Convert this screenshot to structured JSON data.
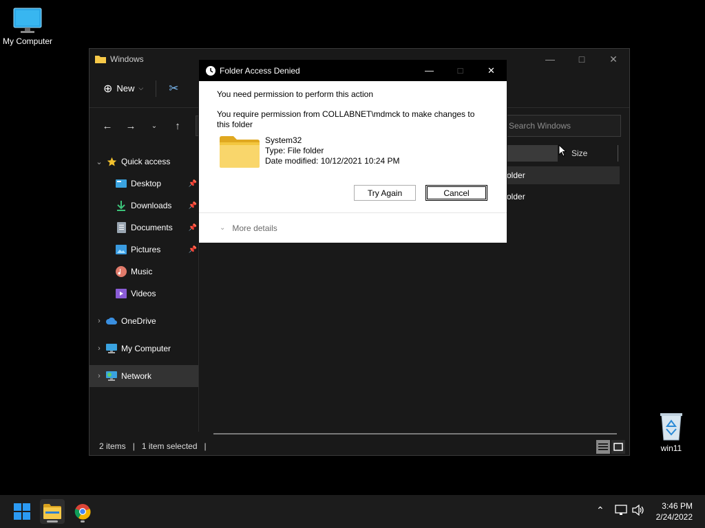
{
  "desktop": {
    "icons": [
      {
        "label": "My Computer"
      },
      {
        "label": "win11"
      }
    ]
  },
  "explorer": {
    "title": "Windows",
    "toolbar": {
      "new_label": "New"
    },
    "search_placeholder": "Search Windows",
    "sidebar": {
      "quick_access": "Quick access",
      "items": [
        {
          "label": "Desktop",
          "icon": "desktop-icon",
          "pinned": true
        },
        {
          "label": "Downloads",
          "icon": "download-icon",
          "pinned": true
        },
        {
          "label": "Documents",
          "icon": "document-icon",
          "pinned": true
        },
        {
          "label": "Pictures",
          "icon": "pictures-icon",
          "pinned": true
        },
        {
          "label": "Music",
          "icon": "music-icon",
          "pinned": false
        },
        {
          "label": "Videos",
          "icon": "videos-icon",
          "pinned": false
        }
      ],
      "onedrive": "OneDrive",
      "mycomputer": "My Computer",
      "network": "Network"
    },
    "columns": {
      "size": "Size"
    },
    "rows": [
      {
        "type": "older"
      },
      {
        "type": "older"
      }
    ],
    "status": {
      "items": "2 items",
      "selected": "1 item selected"
    }
  },
  "dialog": {
    "title": "Folder Access Denied",
    "message1": "You need permission to perform this action",
    "message2": "You require permission from COLLABNET\\mdmck to make changes to this folder",
    "file": {
      "name": "System32",
      "type": "Type: File folder",
      "modified": "Date modified: 10/12/2021 10:24 PM"
    },
    "try_again": "Try Again",
    "cancel": "Cancel",
    "more_details": "More details"
  },
  "taskbar": {
    "time": "3:46 PM",
    "date": "2/24/2022"
  },
  "colors": {
    "folder_yellow": "#f7c948",
    "windows_blue": "#2b9af3",
    "desktop_bg": "#000000"
  }
}
